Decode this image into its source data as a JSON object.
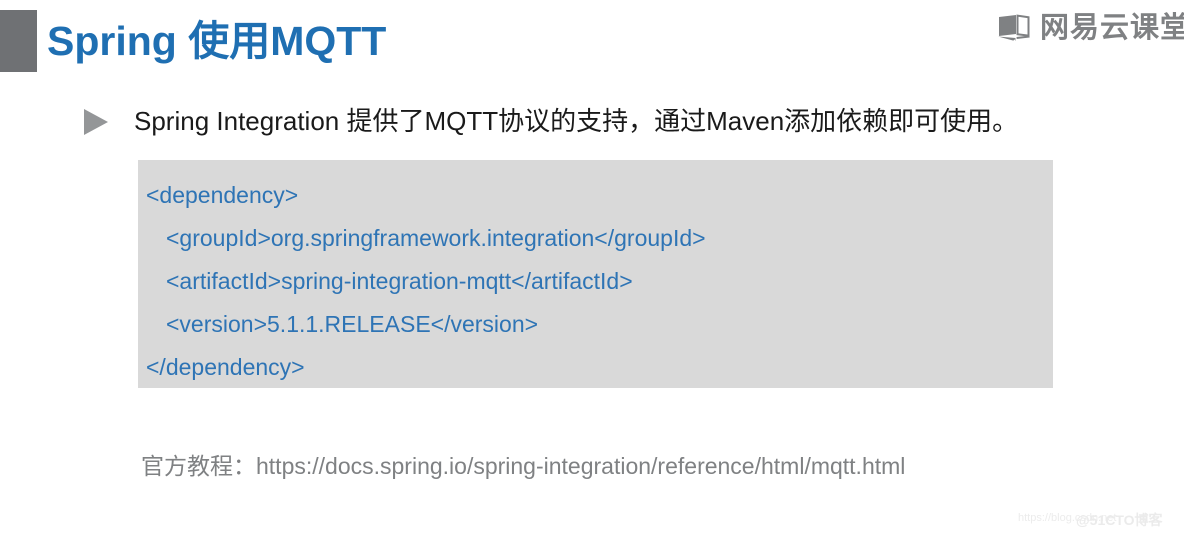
{
  "slide": {
    "title": "Spring 使用MQTT",
    "title_color": "#1f6fb2",
    "marker_color": "#6f7174",
    "background": "#ffffff"
  },
  "brand": {
    "icon": "open-book-icon",
    "name": "网易云课堂",
    "color": "#7f8183"
  },
  "bullet": {
    "marker": "triangle-right-icon",
    "marker_color": "#949698",
    "text": "Spring Integration 提供了MQTT协议的支持，通过Maven添加依赖即可使用。"
  },
  "code_block": {
    "background": "#d9d9d9",
    "text_color": "#2e74b5",
    "lines": [
      {
        "text": "<dependency>",
        "indent": false
      },
      {
        "text": "<groupId>org.springframework.integration</groupId>",
        "indent": true
      },
      {
        "text": "<artifactId>spring-integration-mqtt</artifactId>",
        "indent": true
      },
      {
        "text": "<version>5.1.1.RELEASE</version>",
        "indent": true
      },
      {
        "text": "</dependency>",
        "indent": false
      }
    ]
  },
  "footnote": {
    "text": "官方教程：https://docs.spring.io/spring-integration/reference/html/mqtt.html",
    "color": "#7f8183"
  },
  "watermark": {
    "url": "https://blog.csdn.net",
    "tag": "@51CTO博客"
  }
}
